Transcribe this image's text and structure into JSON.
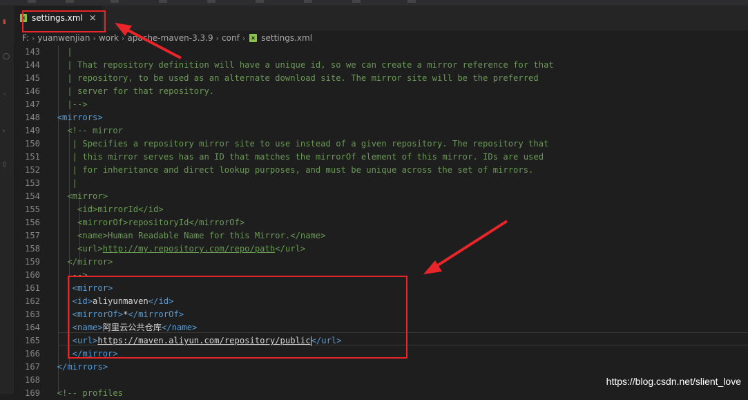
{
  "tab": {
    "label": "settings.xml",
    "close_glyph": "×"
  },
  "breadcrumbs": [
    "F:",
    "yuanwenjian",
    "work",
    "apache-maven-3.3.9",
    "conf",
    "settings.xml"
  ],
  "colors": {
    "comment": "#6a9955",
    "tag": "#569cd6",
    "text": "#d4d4d4",
    "highlight": "#e8262a"
  },
  "lines": [
    {
      "n": "143",
      "segs": [
        [
          "c",
          "    |"
        ]
      ]
    },
    {
      "n": "144",
      "segs": [
        [
          "c",
          "    | That repository definition will have a unique id, so we can create a mirror reference for that"
        ]
      ]
    },
    {
      "n": "145",
      "segs": [
        [
          "c",
          "    | repository, to be used as an alternate download site. The mirror site will be the preferred"
        ]
      ]
    },
    {
      "n": "146",
      "segs": [
        [
          "c",
          "    | server for that repository."
        ]
      ]
    },
    {
      "n": "147",
      "segs": [
        [
          "c",
          "    |-->"
        ]
      ]
    },
    {
      "n": "148",
      "segs": [
        [
          "t",
          "  <mirrors>"
        ]
      ]
    },
    {
      "n": "149",
      "segs": [
        [
          "c",
          "    <!-- mirror"
        ]
      ]
    },
    {
      "n": "150",
      "segs": [
        [
          "c",
          "     | Specifies a repository mirror site to use instead of a given repository. The repository that"
        ]
      ]
    },
    {
      "n": "151",
      "segs": [
        [
          "c",
          "     | this mirror serves has an ID that matches the mirrorOf element of this mirror. IDs are used"
        ]
      ]
    },
    {
      "n": "152",
      "segs": [
        [
          "c",
          "     | for inheritance and direct lookup purposes, and must be unique across the set of mirrors."
        ]
      ]
    },
    {
      "n": "153",
      "segs": [
        [
          "c",
          "     |"
        ]
      ]
    },
    {
      "n": "154",
      "segs": [
        [
          "c",
          "    <mirror>"
        ]
      ]
    },
    {
      "n": "155",
      "segs": [
        [
          "c",
          "      <id>mirrorId</id>"
        ]
      ]
    },
    {
      "n": "156",
      "segs": [
        [
          "c",
          "      <mirrorOf>repositoryId</mirrorOf>"
        ]
      ]
    },
    {
      "n": "157",
      "segs": [
        [
          "c",
          "      <name>Human Readable Name for this Mirror.</name>"
        ]
      ]
    },
    {
      "n": "158",
      "segs": [
        [
          "c",
          "      <url>"
        ],
        [
          "cu",
          "http://my.repository.com/repo/path"
        ],
        [
          "c",
          "</url>"
        ]
      ]
    },
    {
      "n": "159",
      "segs": [
        [
          "c",
          "    </mirror>"
        ]
      ]
    },
    {
      "n": "160",
      "segs": [
        [
          "c",
          "     -->"
        ]
      ]
    },
    {
      "n": "161",
      "segs": [
        [
          "t",
          "     <mirror>"
        ]
      ]
    },
    {
      "n": "162",
      "segs": [
        [
          "t",
          "     <id>"
        ],
        [
          "tx",
          "aliyunmaven"
        ],
        [
          "t",
          "</id>"
        ]
      ]
    },
    {
      "n": "163",
      "segs": [
        [
          "t",
          "     <mirrorOf>"
        ],
        [
          "tx",
          "*"
        ],
        [
          "t",
          "</mirrorOf>"
        ]
      ]
    },
    {
      "n": "164",
      "segs": [
        [
          "t",
          "     <name>"
        ],
        [
          "tx",
          "阿里云公共仓库"
        ],
        [
          "t",
          "</name>"
        ]
      ]
    },
    {
      "n": "165",
      "segs": [
        [
          "t",
          "     <url>"
        ],
        [
          "u",
          "https://maven.aliyun.com/repository/public"
        ],
        [
          "t",
          "</url>"
        ]
      ]
    },
    {
      "n": "166",
      "segs": [
        [
          "t",
          "     </mirror>"
        ]
      ]
    },
    {
      "n": "167",
      "segs": [
        [
          "t",
          "  </mirrors>"
        ]
      ]
    },
    {
      "n": "168",
      "segs": []
    },
    {
      "n": "169",
      "segs": [
        [
          "c",
          "  <!-- profiles"
        ]
      ]
    }
  ],
  "watermark": "https://blog.csdn.net/slient_love"
}
